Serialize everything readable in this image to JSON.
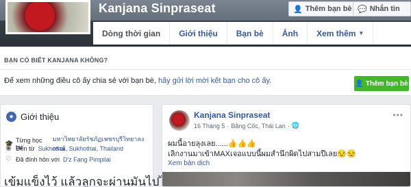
{
  "profile": {
    "name": "Kanjana Sinpraseat",
    "add_friend_label": "Thêm bạn bè",
    "message_label": "Nhắn tin"
  },
  "tabs": [
    {
      "label": "Dòng thời gian"
    },
    {
      "label": "Giới thiệu"
    },
    {
      "label": "Bạn bè"
    },
    {
      "label": "Ảnh"
    },
    {
      "label": "Xem thêm"
    }
  ],
  "know_banner": {
    "title": "BẠN CÓ BIẾT KANJANA KHÔNG?",
    "text_prefix": "Để xem những điều cô ấy chia sẻ với bạn bè, ",
    "text_link": "hãy gửi lời mời kết bạn cho cô ấy.",
    "button_label": "Thêm bạn bè"
  },
  "intro": {
    "title": "Giới thiệu",
    "studied_prefix": "Từng học tại ",
    "studied_link": "มหาวิทยาลัยรัชภัฏเพชรบุรีวิทยาลงกรณ์",
    "from_prefix": "Đến từ ",
    "from_link": "Sukhothai, Sukhothai, Thailand",
    "married_prefix": "Đã đính hôn với ",
    "married_link": "D'z Fang Pimpilai",
    "big_text": "เข้มแข็งไว้ แล้วลูกจะผ่านมันไปได้"
  },
  "post": {
    "author": "Kanjana Sinpraseat",
    "date": "16 Tháng 5",
    "location": "Bằng Cốc, Thái Lan",
    "line1": "ผมนี้อายลุงเลย......👍👍👍",
    "line2": "เลิกงานมาเข้าMAXเจอแบบนี้ผมสำนึกผิดไปสามปีเลย😒😒",
    "translate_label": "Xem bản dịch",
    "more_icon": "more-dots-icon"
  },
  "colors": {
    "link": "#365899",
    "green": "#42b72a",
    "background": "#e9ebee"
  }
}
